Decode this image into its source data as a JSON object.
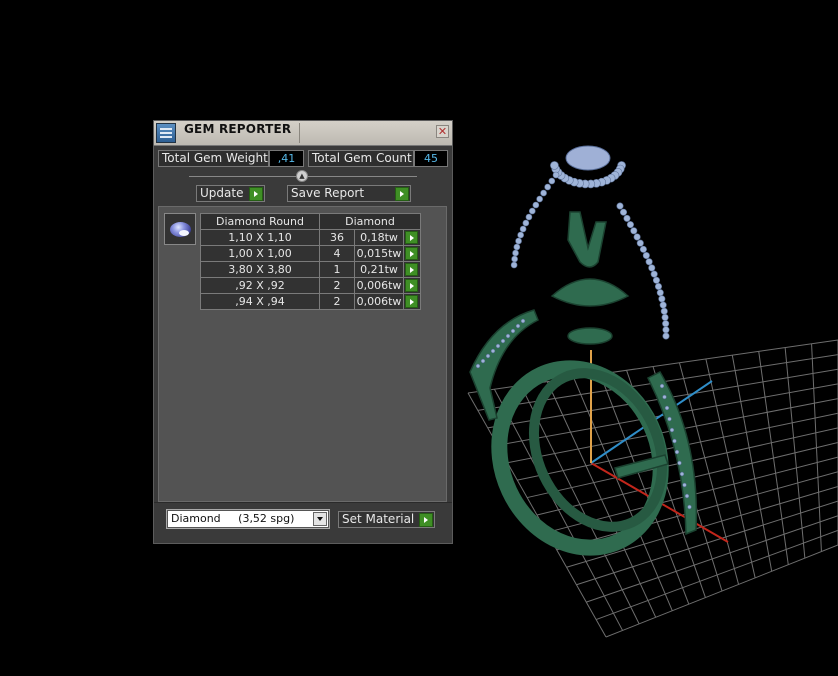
{
  "window": {
    "title": "GEM REPORTER",
    "close_glyph": "✕"
  },
  "stats": {
    "total_weight_label": "Total Gem Weight",
    "total_weight_value": ",41",
    "total_count_label": "Total Gem Count",
    "total_count_value": "45"
  },
  "buttons": {
    "update": "Update",
    "save_report": "Save Report",
    "set_material": "Set Material"
  },
  "table": {
    "headers": [
      "Diamond Round",
      "Diamond"
    ],
    "rows": [
      {
        "size": "1,10 X 1,10",
        "count": "36",
        "weight": "0,18tw"
      },
      {
        "size": "1,00 X 1,00",
        "count": "4",
        "weight": "0,015tw"
      },
      {
        "size": "3,80 X 3,80",
        "count": "1",
        "weight": "0,21tw"
      },
      {
        "size": ",92 X ,92",
        "count": "2",
        "weight": "0,006tw"
      },
      {
        "size": ",94 X ,94",
        "count": "2",
        "weight": "0,006tw"
      }
    ]
  },
  "material": {
    "selected": "Diamond     (3,52 spg)"
  },
  "colors": {
    "model": "#2f6b4f",
    "gem": "#8a93e0",
    "accent_button": "#3f8f25",
    "value_text": "#56b8e8"
  },
  "icons": {
    "app": "gem-reporter-app-icon",
    "gem_thumb": "round-diamond-icon",
    "action": "green-play-arrow-icon"
  }
}
